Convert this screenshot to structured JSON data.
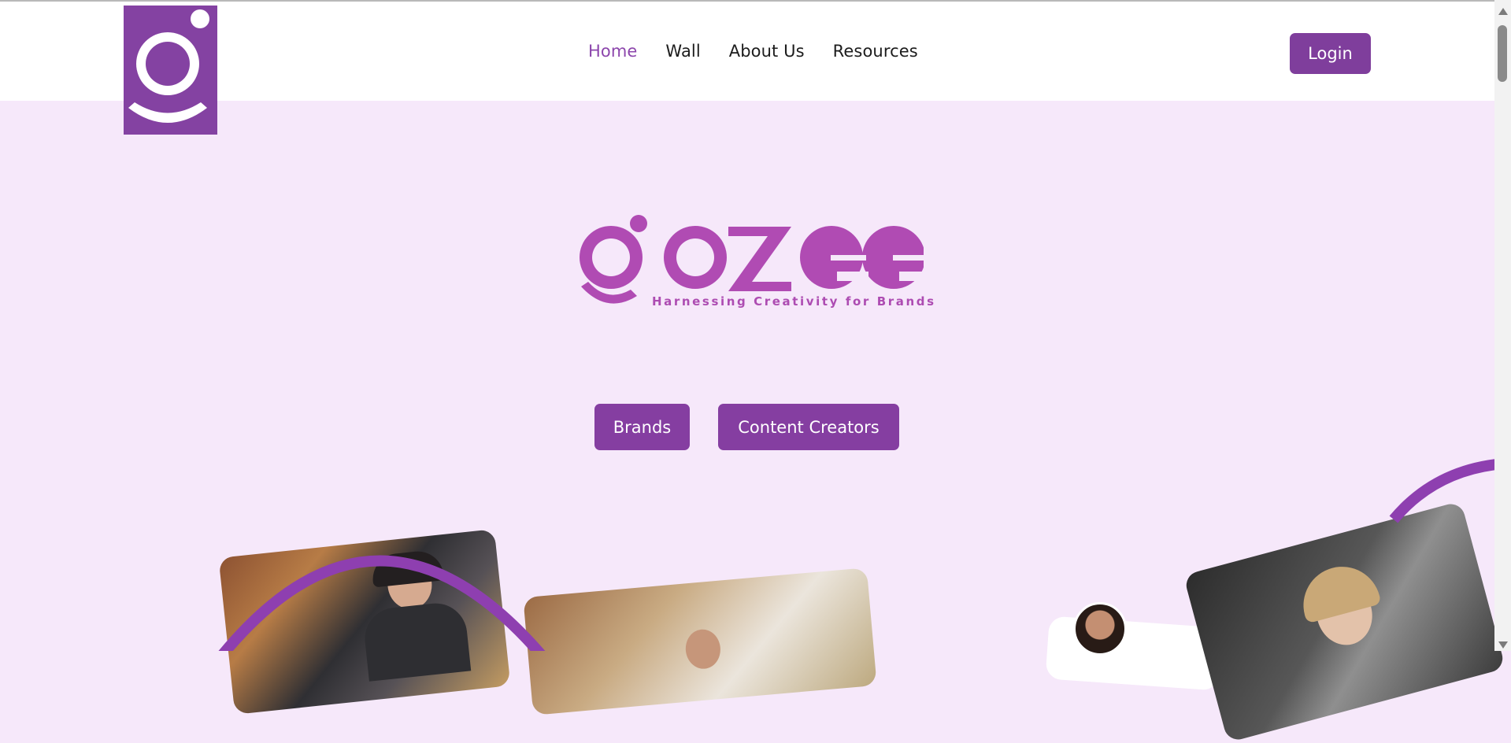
{
  "brand": {
    "name": "gozee",
    "tagline": "Harnessing Creativity for Brands",
    "color": "#8442a2",
    "accent": "#b04bb3"
  },
  "nav": {
    "items": [
      {
        "label": "Home",
        "active": true
      },
      {
        "label": "Wall",
        "active": false
      },
      {
        "label": "About Us",
        "active": false
      },
      {
        "label": "Resources",
        "active": false
      }
    ],
    "login_label": "Login"
  },
  "hero": {
    "buttons": {
      "brands": "Brands",
      "creators": "Content Creators"
    }
  },
  "images": [
    {
      "name": "podcaster-woman-headphones"
    },
    {
      "name": "man-at-table"
    },
    {
      "name": "creator-avatar"
    },
    {
      "name": "woman-podcast-studio"
    }
  ]
}
